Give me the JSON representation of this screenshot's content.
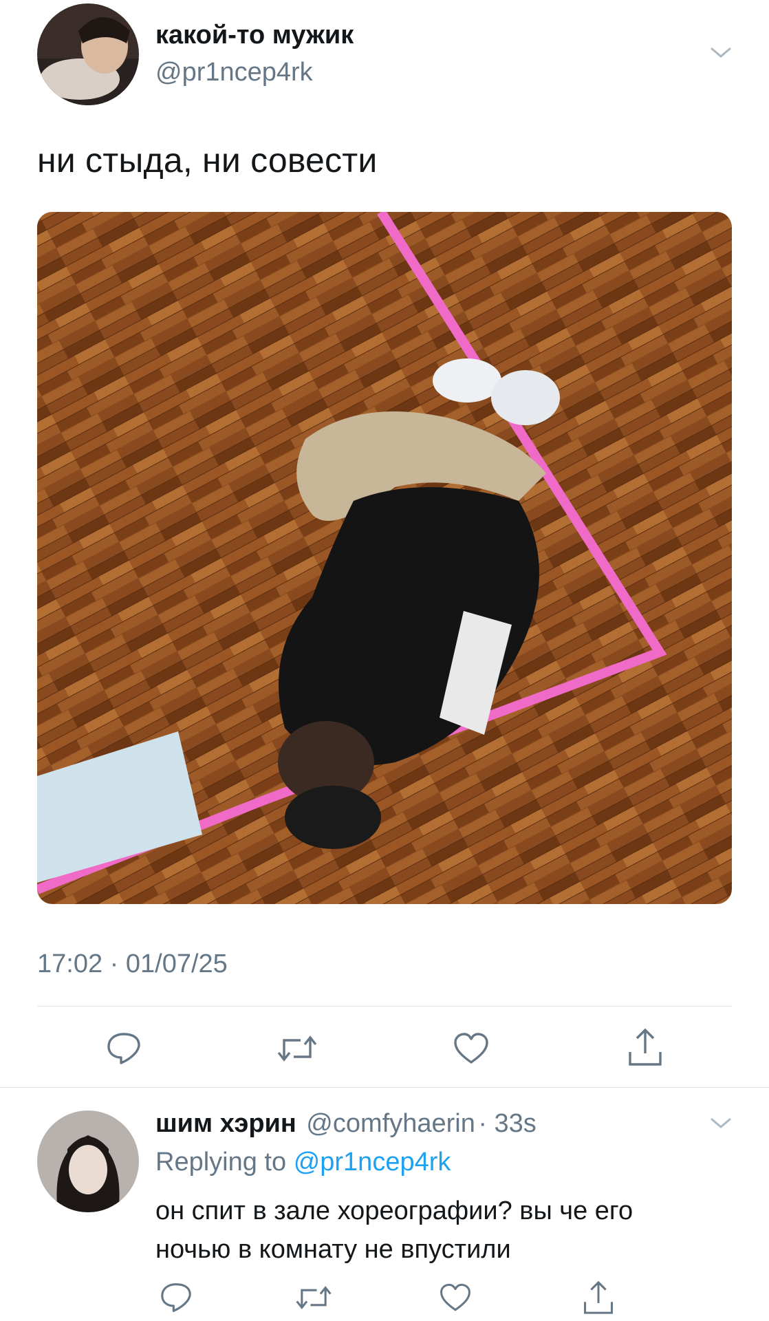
{
  "tweet": {
    "author_name": "какой-то мужик",
    "author_handle": "@pr1ncep4rk",
    "text": "ни стыда, ни совести",
    "timestamp": "17:02 · 01/07/25",
    "actions": [
      "reply-icon",
      "retweet-icon",
      "like-icon",
      "share-icon"
    ]
  },
  "reply": {
    "author_name": "шим хэрин",
    "author_handle": "@comfyhaerin",
    "time": "· 33s",
    "replying_label": "Replying to",
    "replying_handle": "@pr1ncep4rk",
    "text_line1": "он спит в зале хореографии? вы че его",
    "text_line2": "ночью в комнату не впустили",
    "actions": [
      "reply-icon",
      "retweet-icon",
      "like-icon",
      "share-icon"
    ]
  },
  "colors": {
    "secondary_text": "#657786",
    "link": "#1da1f2",
    "divider": "#e1e8ed",
    "floor": "#8a4a1f",
    "tape": "#f06ac8"
  }
}
